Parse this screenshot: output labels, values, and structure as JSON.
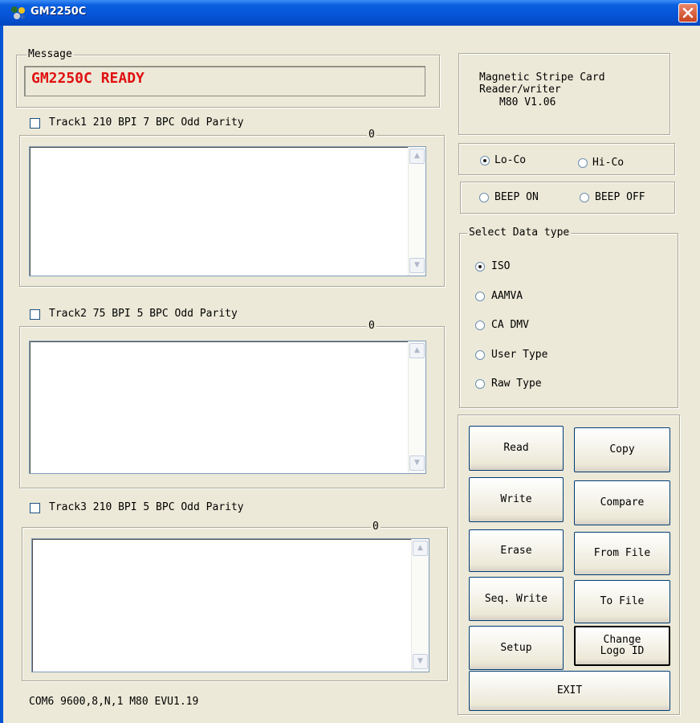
{
  "window": {
    "title": "GM2250C",
    "icon": "app-icon",
    "close_icon": "close-icon"
  },
  "message": {
    "legend": "Message",
    "text": "GM2250C READY"
  },
  "tracks": [
    {
      "label": "Track1 210 BPI 7 BPC Odd Parity",
      "count": "0",
      "checked": false
    },
    {
      "label": "Track2 75 BPI 5 BPC Odd Parity",
      "count": "0",
      "checked": false
    },
    {
      "label": "Track3 210 BPI 5 BPC Odd Parity",
      "count": "0",
      "checked": false
    }
  ],
  "info": {
    "line1": "Magnetic Stripe Card",
    "line2": "Reader/writer",
    "line3": "M80  V1.06"
  },
  "coercivity": {
    "lo": "Lo-Co",
    "hi": "Hi-Co",
    "selected": "Lo-Co"
  },
  "beep": {
    "on": "BEEP ON",
    "off": "BEEP OFF",
    "selected": ""
  },
  "data_type": {
    "legend": "Select Data type",
    "options": [
      "ISO",
      "AAMVA",
      "CA DMV",
      "User Type",
      "Raw Type"
    ],
    "selected": "ISO"
  },
  "buttons": {
    "read": "Read",
    "copy": "Copy",
    "write": "Write",
    "compare": "Compare",
    "erase": "Erase",
    "from_file": "From File",
    "seq_write": "Seq. Write",
    "to_file": "To File",
    "setup": "Setup",
    "change_logo_1": "Change",
    "change_logo_2": "Logo ID",
    "exit": "EXIT"
  },
  "status": "COM6 9600,8,N,1  M80 EVU1.19",
  "colors": {
    "title_bar": "#0554d6",
    "message_text": "#e01010",
    "dialog_bg": "#ece9d8"
  }
}
